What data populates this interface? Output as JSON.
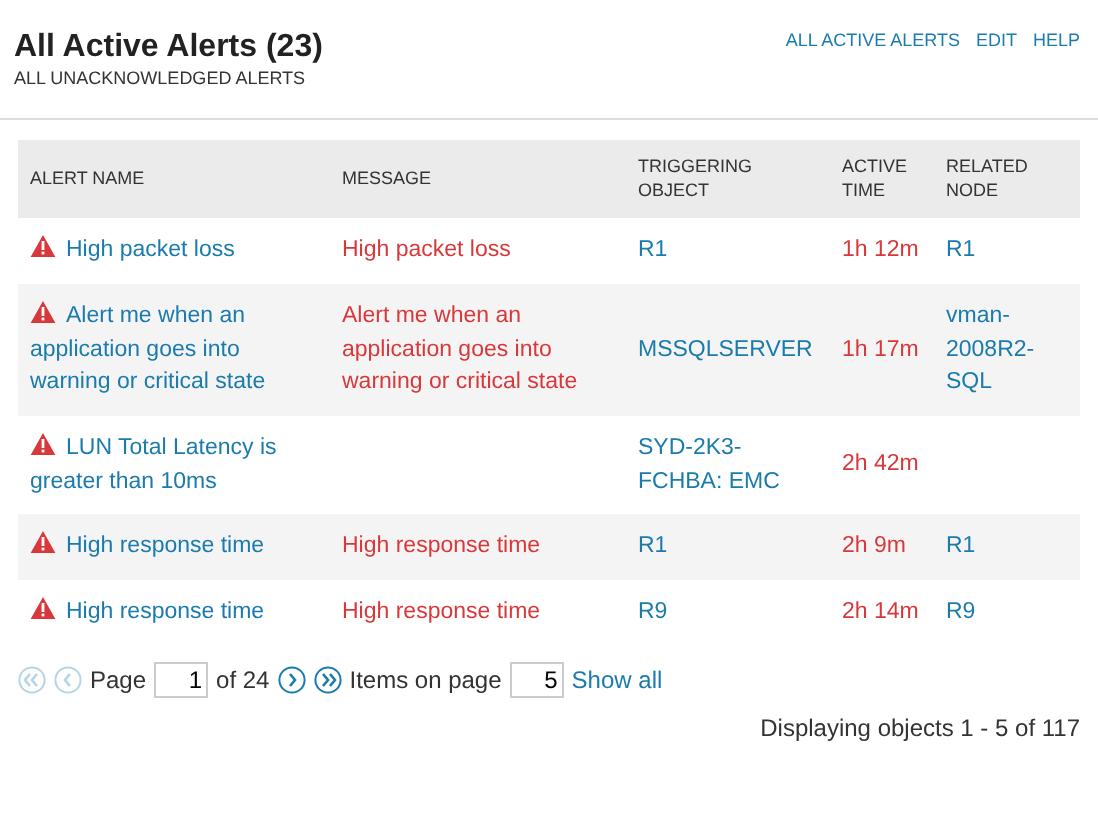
{
  "header": {
    "title": "All Active Alerts (23)",
    "subtitle": "ALL UNACKNOWLEDGED ALERTS",
    "links": [
      "ALL ACTIVE ALERTS",
      "EDIT",
      "HELP"
    ]
  },
  "table": {
    "columns": [
      "ALERT NAME",
      "MESSAGE",
      "TRIGGERING OBJECT",
      "ACTIVE TIME",
      "RELATED NODE"
    ],
    "rows": [
      {
        "alert_name": "High packet loss",
        "message": "High packet loss",
        "triggering_object": "R1",
        "active_time": "1h 12m",
        "related_node": "R1"
      },
      {
        "alert_name": "Alert me when an application goes into warning or critical state",
        "message": "Alert me when an application goes into warning or critical state",
        "triggering_object": "MSSQLSERVER",
        "active_time": "1h 17m",
        "related_node": "vman-2008R2-SQL"
      },
      {
        "alert_name": "LUN Total Latency is greater than 10ms",
        "triggering_object": "SYD-2K3-FCHBA: EMC",
        "active_time": "2h 42m"
      },
      {
        "alert_name": "High response time",
        "message": "High response time",
        "triggering_object": "R1",
        "active_time": "2h 9m",
        "related_node": "R1"
      },
      {
        "alert_name": "High response time",
        "message": "High response time",
        "triggering_object": "R9",
        "active_time": "2h 14m",
        "related_node": "R9"
      }
    ]
  },
  "pager": {
    "first": {
      "disabled": true
    },
    "previous": {
      "disabled": true
    },
    "page_label": "Page",
    "page": "1",
    "of_label": "of 24",
    "next": {
      "disabled": false
    },
    "last": {
      "disabled": false
    },
    "items_label": "Items on page",
    "items": "5",
    "show_all": "Show all",
    "status": "Displaying objects 1 - 5 of 117"
  }
}
